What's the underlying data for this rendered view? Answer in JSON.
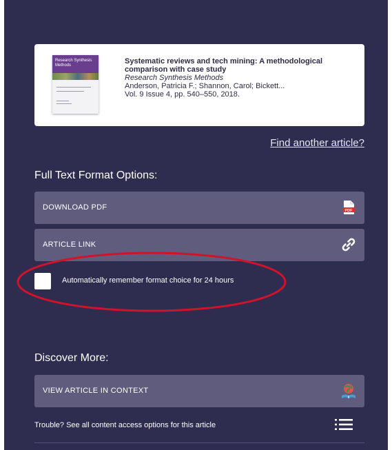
{
  "article": {
    "cover_title": "Research Synthesis Methods",
    "title": "Systematic reviews and tech mining: A methodological comparison with case study",
    "journal": "Research Synthesis Methods",
    "authors": "Anderson, Patricia F.; Shannon, Carol; Bickett...",
    "citation": "Vol. 9 Issue 4, pp. 540–550, 2018."
  },
  "find_another": "Find another article?",
  "full_text": {
    "heading": "Full Text Format Options:",
    "options": [
      {
        "label": "DOWNLOAD PDF",
        "icon": "pdf-icon"
      },
      {
        "label": "ARTICLE LINK",
        "icon": "link-icon"
      }
    ],
    "remember_label": "Automatically remember format choice for 24 hours",
    "remember_checked": false,
    "pdf_badge": "PDF"
  },
  "discover": {
    "heading": "Discover More:",
    "view_context_label": "VIEW ARTICLE IN CONTEXT",
    "view_context_icon": "book-globe-icon"
  },
  "trouble_text": "Trouble? See all content access options for this article",
  "colors": {
    "panel_bg": "#2e2c4f",
    "button_bg": "#5f5c7d",
    "annotation": "#d0132b",
    "pdf_red": "#d9322a"
  }
}
